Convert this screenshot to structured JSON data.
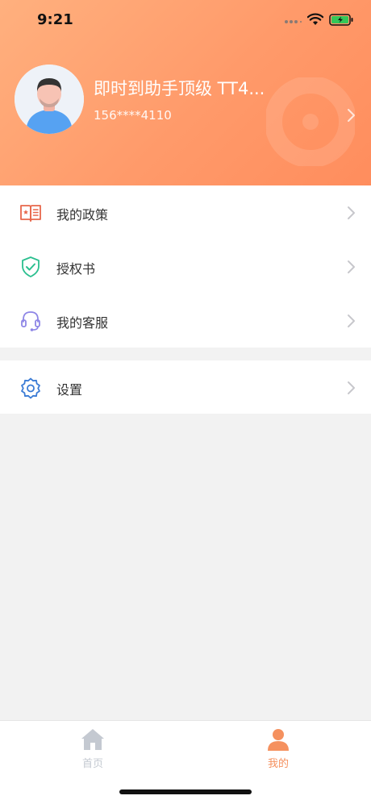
{
  "status_bar": {
    "time": "9:21"
  },
  "profile": {
    "name": "即时到助手顶级 TT4...",
    "phone": "156****4110"
  },
  "menu": {
    "items": [
      {
        "label": "我的政策",
        "icon": "policy-book-icon",
        "color": "#e8674b"
      },
      {
        "label": "授权书",
        "icon": "shield-check-icon",
        "color": "#2bbf8f"
      },
      {
        "label": "我的客服",
        "icon": "headset-icon",
        "color": "#8e86e6"
      }
    ],
    "settings": {
      "label": "设置",
      "icon": "gear-icon",
      "color": "#3a7bd5"
    }
  },
  "tabs": [
    {
      "label": "首页",
      "icon": "home-icon",
      "active": false
    },
    {
      "label": "我的",
      "icon": "person-icon",
      "active": true
    }
  ],
  "colors": {
    "header_gradient_start": "#ffb07e",
    "header_gradient_end": "#ff8d5d",
    "tab_active": "#f5915f",
    "tab_inactive": "#c4c9d1",
    "background": "#f2f2f2"
  }
}
